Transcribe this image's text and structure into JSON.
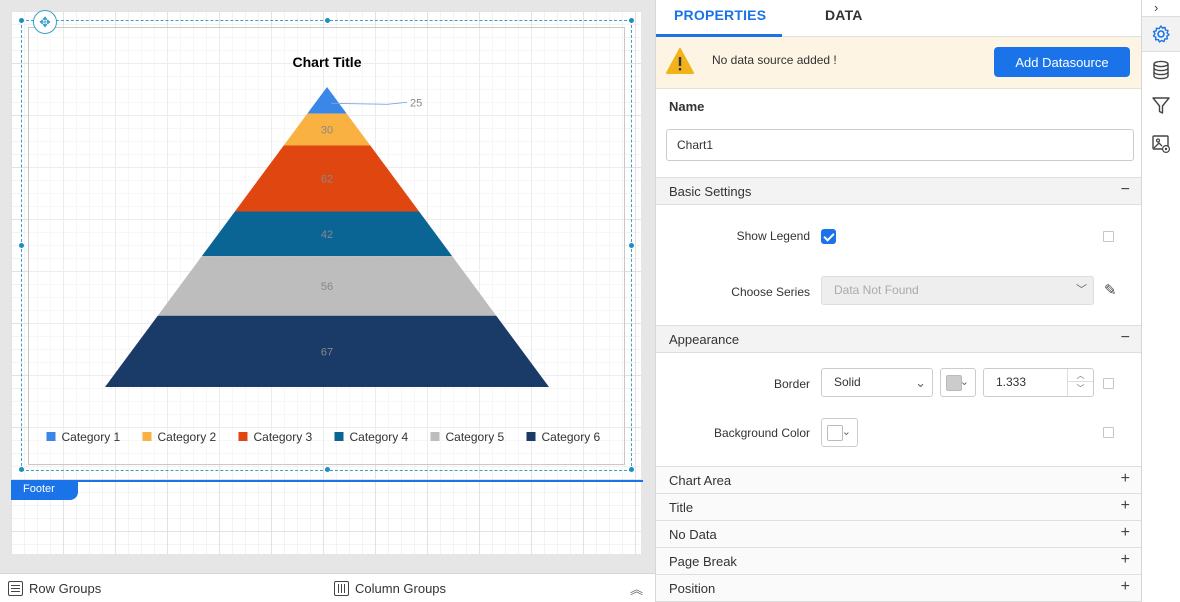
{
  "canvas": {
    "footer_label": "Footer",
    "chart_data": {
      "type": "pyramid",
      "title": "Chart Title",
      "categories": [
        "Category 1",
        "Category 2",
        "Category 3",
        "Category 4",
        "Category 5",
        "Category 6"
      ],
      "values": [
        25,
        30,
        62,
        42,
        56,
        67
      ],
      "colors": [
        "#3b87e8",
        "#f9b141",
        "#e04610",
        "#0b6594",
        "#bdbdbd",
        "#1a3a68"
      ],
      "data_labels": [
        "25",
        "30",
        "62",
        "42",
        "56",
        "67"
      ],
      "legend_position": "bottom"
    }
  },
  "bottom_bar": {
    "row_groups": "Row Groups",
    "column_groups": "Column Groups"
  },
  "panel": {
    "tabs": [
      "PROPERTIES",
      "DATA"
    ],
    "active_tab": "PROPERTIES",
    "alert_text": "No data source added !",
    "add_datasource": "Add Datasource",
    "name_label": "Name",
    "name_value": "Chart1",
    "basic_settings": {
      "title": "Basic Settings",
      "show_legend_label": "Show Legend",
      "show_legend_checked": true,
      "choose_series_label": "Choose Series",
      "choose_series_value": "Data Not Found"
    },
    "appearance": {
      "title": "Appearance",
      "border_label": "Border",
      "border_style": "Solid",
      "border_color": "#cccccc",
      "border_width": "1.333",
      "background_label": "Background Color",
      "background_color": "#ffffff"
    },
    "collapsed_sections": [
      "Chart Area",
      "Title",
      "No Data",
      "Page Break",
      "Position"
    ],
    "toggle_expanded": "−",
    "toggle_collapsed": "+"
  },
  "rail": {
    "expand_icon": "chevron-right-icon",
    "items": [
      "gear-icon",
      "database-icon",
      "filter-icon",
      "image-settings-icon"
    ],
    "active": "gear-icon"
  }
}
